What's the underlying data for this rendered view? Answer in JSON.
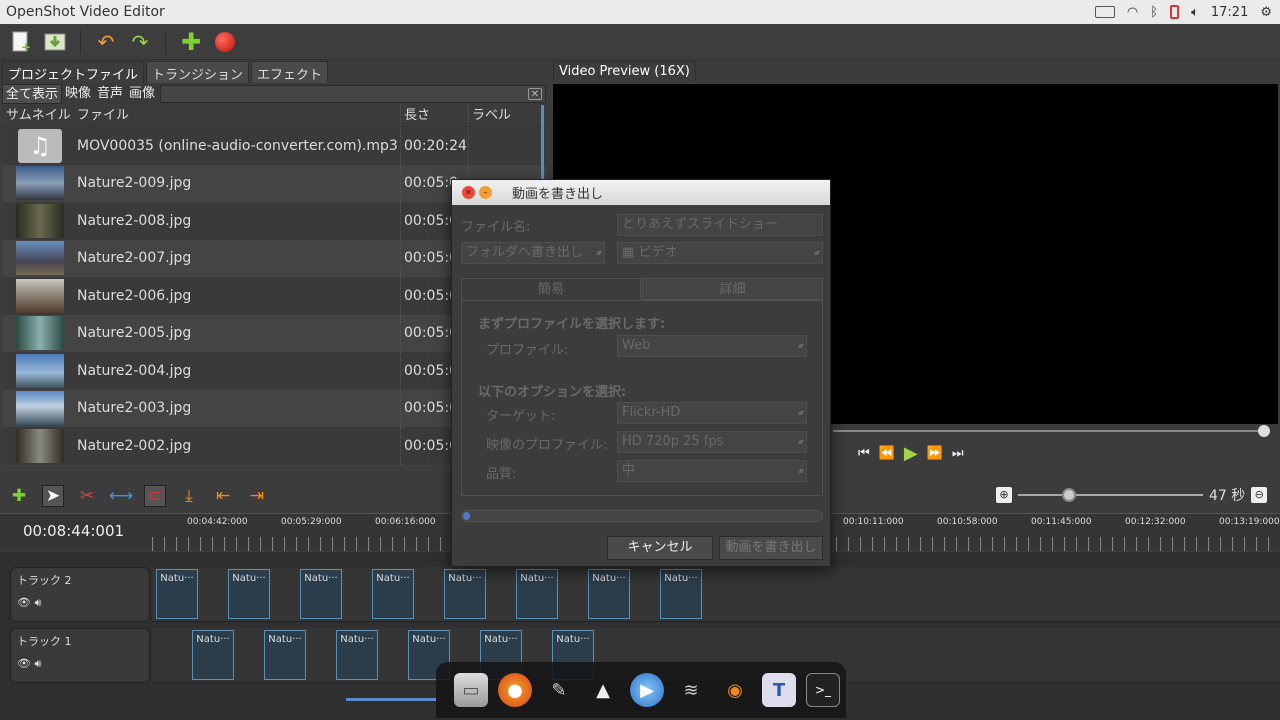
{
  "system_bar": {
    "app_title": "OpenShot Video Editor",
    "clock": "17:21"
  },
  "left_panel": {
    "tabs": [
      "プロジェクトファイル",
      "トランジション",
      "エフェクト"
    ],
    "filters": [
      "全て表示",
      "映像",
      "音声",
      "画像"
    ],
    "columns": {
      "thumb": "サムネイル",
      "file": "ファイル",
      "length": "長さ",
      "label": "ラベル"
    },
    "files": [
      {
        "name": "MOV00035 (online-audio-converter.com).mp3",
        "length": "00:20:24"
      },
      {
        "name": "Nature2-009.jpg",
        "length": "00:05:0"
      },
      {
        "name": "Nature2-008.jpg",
        "length": "00:05:0"
      },
      {
        "name": "Nature2-007.jpg",
        "length": "00:05:0"
      },
      {
        "name": "Nature2-006.jpg",
        "length": "00:05:0"
      },
      {
        "name": "Nature2-005.jpg",
        "length": "00:05:0"
      },
      {
        "name": "Nature2-004.jpg",
        "length": "00:05:0"
      },
      {
        "name": "Nature2-003.jpg",
        "length": "00:05:0"
      },
      {
        "name": "Nature2-002.jpg",
        "length": "00:05:0"
      }
    ]
  },
  "preview": {
    "tab_label": "Video Preview (16X)"
  },
  "timeline": {
    "current_time": "00:08:44:001",
    "zoom_label": "47 秒",
    "ruler_labels": [
      "00:04:42:000",
      "00:05:29:000",
      "00:06:16:000",
      "00:10:11:000",
      "00:10:58:000",
      "00:11:45:000",
      "00:12:32:000",
      "00:13:19:000"
    ],
    "tracks": [
      {
        "name": "トラック 2",
        "clip_label": "Natu···"
      },
      {
        "name": "トラック 1",
        "clip_label": "Natu···"
      }
    ]
  },
  "export_dialog": {
    "title": "動画を書き出し",
    "file_name_label": "ファイル名:",
    "file_name_value": "とりあえずスライドショー",
    "folder_button": "フォルダへ書き出し",
    "type_value": "ビデオ",
    "tab_simple": "簡易",
    "tab_detail": "詳細",
    "section1": "まずプロファイルを選択します:",
    "profile_label": "プロファイル:",
    "profile_value": "Web",
    "section2": "以下のオプションを選択:",
    "target_label": "ターゲット:",
    "target_value": "Flickr-HD",
    "video_profile_label": "映像のプロファイル:",
    "video_profile_value": "HD 720p 25 fps",
    "quality_label": "品質:",
    "quality_value": "中",
    "cancel_button": "キャンセル",
    "export_button": "動画を書き出し",
    "progress": 0.02
  }
}
